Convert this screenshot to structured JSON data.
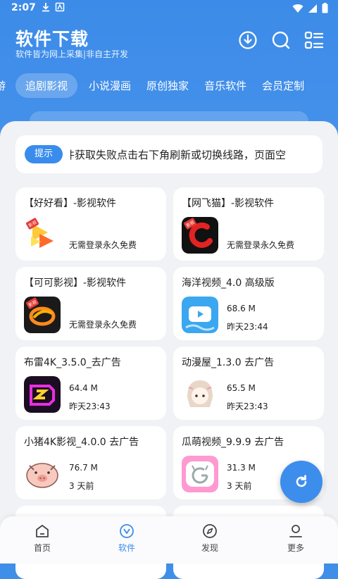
{
  "status_bar": {
    "time": "2:07"
  },
  "header": {
    "title": "软件下载",
    "subtitle": "软件皆为网上采集|非自主开发"
  },
  "tabs": [
    {
      "label": "软游"
    },
    {
      "label": "追剧影视",
      "active": true
    },
    {
      "label": "小说漫画"
    },
    {
      "label": "原创独家"
    },
    {
      "label": "音乐软件"
    },
    {
      "label": "会员定制"
    }
  ],
  "notice": {
    "badge": "提示",
    "text": "软件获取失败点击右下角刷新或切换线路，页面空"
  },
  "cards": [
    {
      "title": "【好好看】-影视软件",
      "desc": "无需登录永久免费",
      "icon": "haohaokan-icon",
      "tag": "影视"
    },
    {
      "title": "【网飞猫】-影视软件",
      "desc": "无需登录永久免费",
      "icon": "wangfeimao-icon",
      "tag": "影视"
    },
    {
      "title": "【可可影视】-影视软件",
      "desc": "无需登录永久免费",
      "icon": "keke-icon",
      "tag": "影视"
    },
    {
      "title": "海洋视频_4.0 高级版",
      "size": "68.6 M",
      "date": "昨天23:44",
      "icon": "haiyang-icon"
    },
    {
      "title": "布雷4K_3.5.0_去广告",
      "size": "64.4 M",
      "date": "昨天23:43",
      "icon": "bulei-icon"
    },
    {
      "title": "动漫屋_1.3.0 去广告",
      "size": "65.5 M",
      "date": "昨天23:43",
      "icon": "dongmanwu-icon"
    },
    {
      "title": "小猪4K影视_4.0.0 去广告",
      "size": "76.7 M",
      "date": "3 天前",
      "icon": "pig-icon"
    },
    {
      "title": "瓜萌视频_9.9.9 去广告",
      "size": "31.3 M",
      "date": "3 天前",
      "icon": "guameng-icon"
    }
  ],
  "bottom_nav": [
    {
      "label": "首页",
      "icon": "home-icon"
    },
    {
      "label": "软件",
      "icon": "software-icon",
      "active": true
    },
    {
      "label": "发现",
      "icon": "compass-icon"
    },
    {
      "label": "更多",
      "icon": "user-icon"
    }
  ],
  "colors": {
    "primary": "#3a8cec",
    "background": "#f1f2f5"
  }
}
